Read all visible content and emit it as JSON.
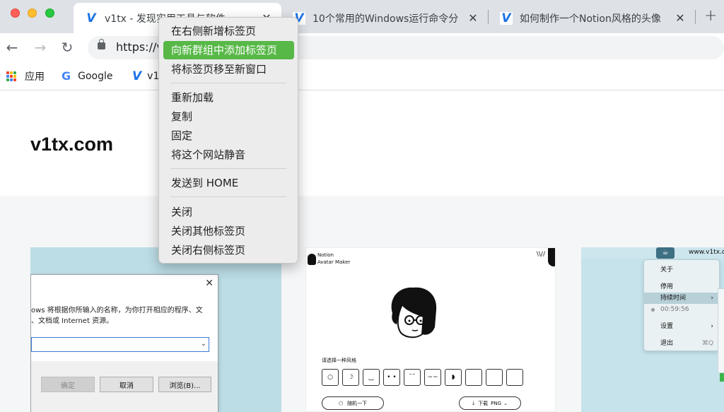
{
  "window": {
    "traffic_lights": [
      "close",
      "minimize",
      "maximize"
    ]
  },
  "tabs": [
    {
      "label": "v1tx - 发现实用工具与软件",
      "close": "✕",
      "active": true
    },
    {
      "label": "10个常用的Windows运行命令分",
      "close": "✕",
      "active": false
    },
    {
      "label": "如何制作一个Notion风格的头像",
      "close": "✕",
      "active": false
    }
  ],
  "new_tab_label": "+",
  "toolbar": {
    "back": "←",
    "forward": "→",
    "reload": "↻",
    "url": "https://v"
  },
  "bookmarks": [
    {
      "label": "应用",
      "icon": "apps-grid-icon"
    },
    {
      "label": "Google",
      "icon": "google-icon"
    },
    {
      "label": "v1",
      "icon": "v1tx-icon"
    }
  ],
  "page": {
    "site_title": "v1tx.com"
  },
  "context_menu": {
    "groups": [
      [
        "在右侧新增标签页",
        "向新群组中添加标签页",
        "将标签页移至新窗口"
      ],
      [
        "重新加载",
        "复制",
        "固定",
        "将这个网站静音"
      ],
      [
        "发送到 HOME"
      ],
      [
        "关闭",
        "关闭其他标签页",
        "关闭右侧标签页"
      ]
    ],
    "highlighted": "向新群组中添加标签页",
    "highlight_color": "#57b847"
  },
  "card_run_dialog": {
    "line1": "ows 将根据你所输入的名称，为你打开相应的程序、文",
    "line2": "、文档或 Internet 资源。",
    "buttons": [
      "确定",
      "取消",
      "浏览(B)..."
    ]
  },
  "card_notion": {
    "brand_line1": "Notion",
    "brand_line2": "Avatar Maker",
    "prompt": "请选择一种风格",
    "random_button": "随机一下",
    "download_button": "下载",
    "download_format": "PNG"
  },
  "card_menubar": {
    "url": "www.v1tx.c",
    "items": [
      "关于",
      "停用",
      "持续时间",
      "00:59:56",
      "设置",
      "退出"
    ],
    "quit_shortcut": "⌘Q"
  }
}
